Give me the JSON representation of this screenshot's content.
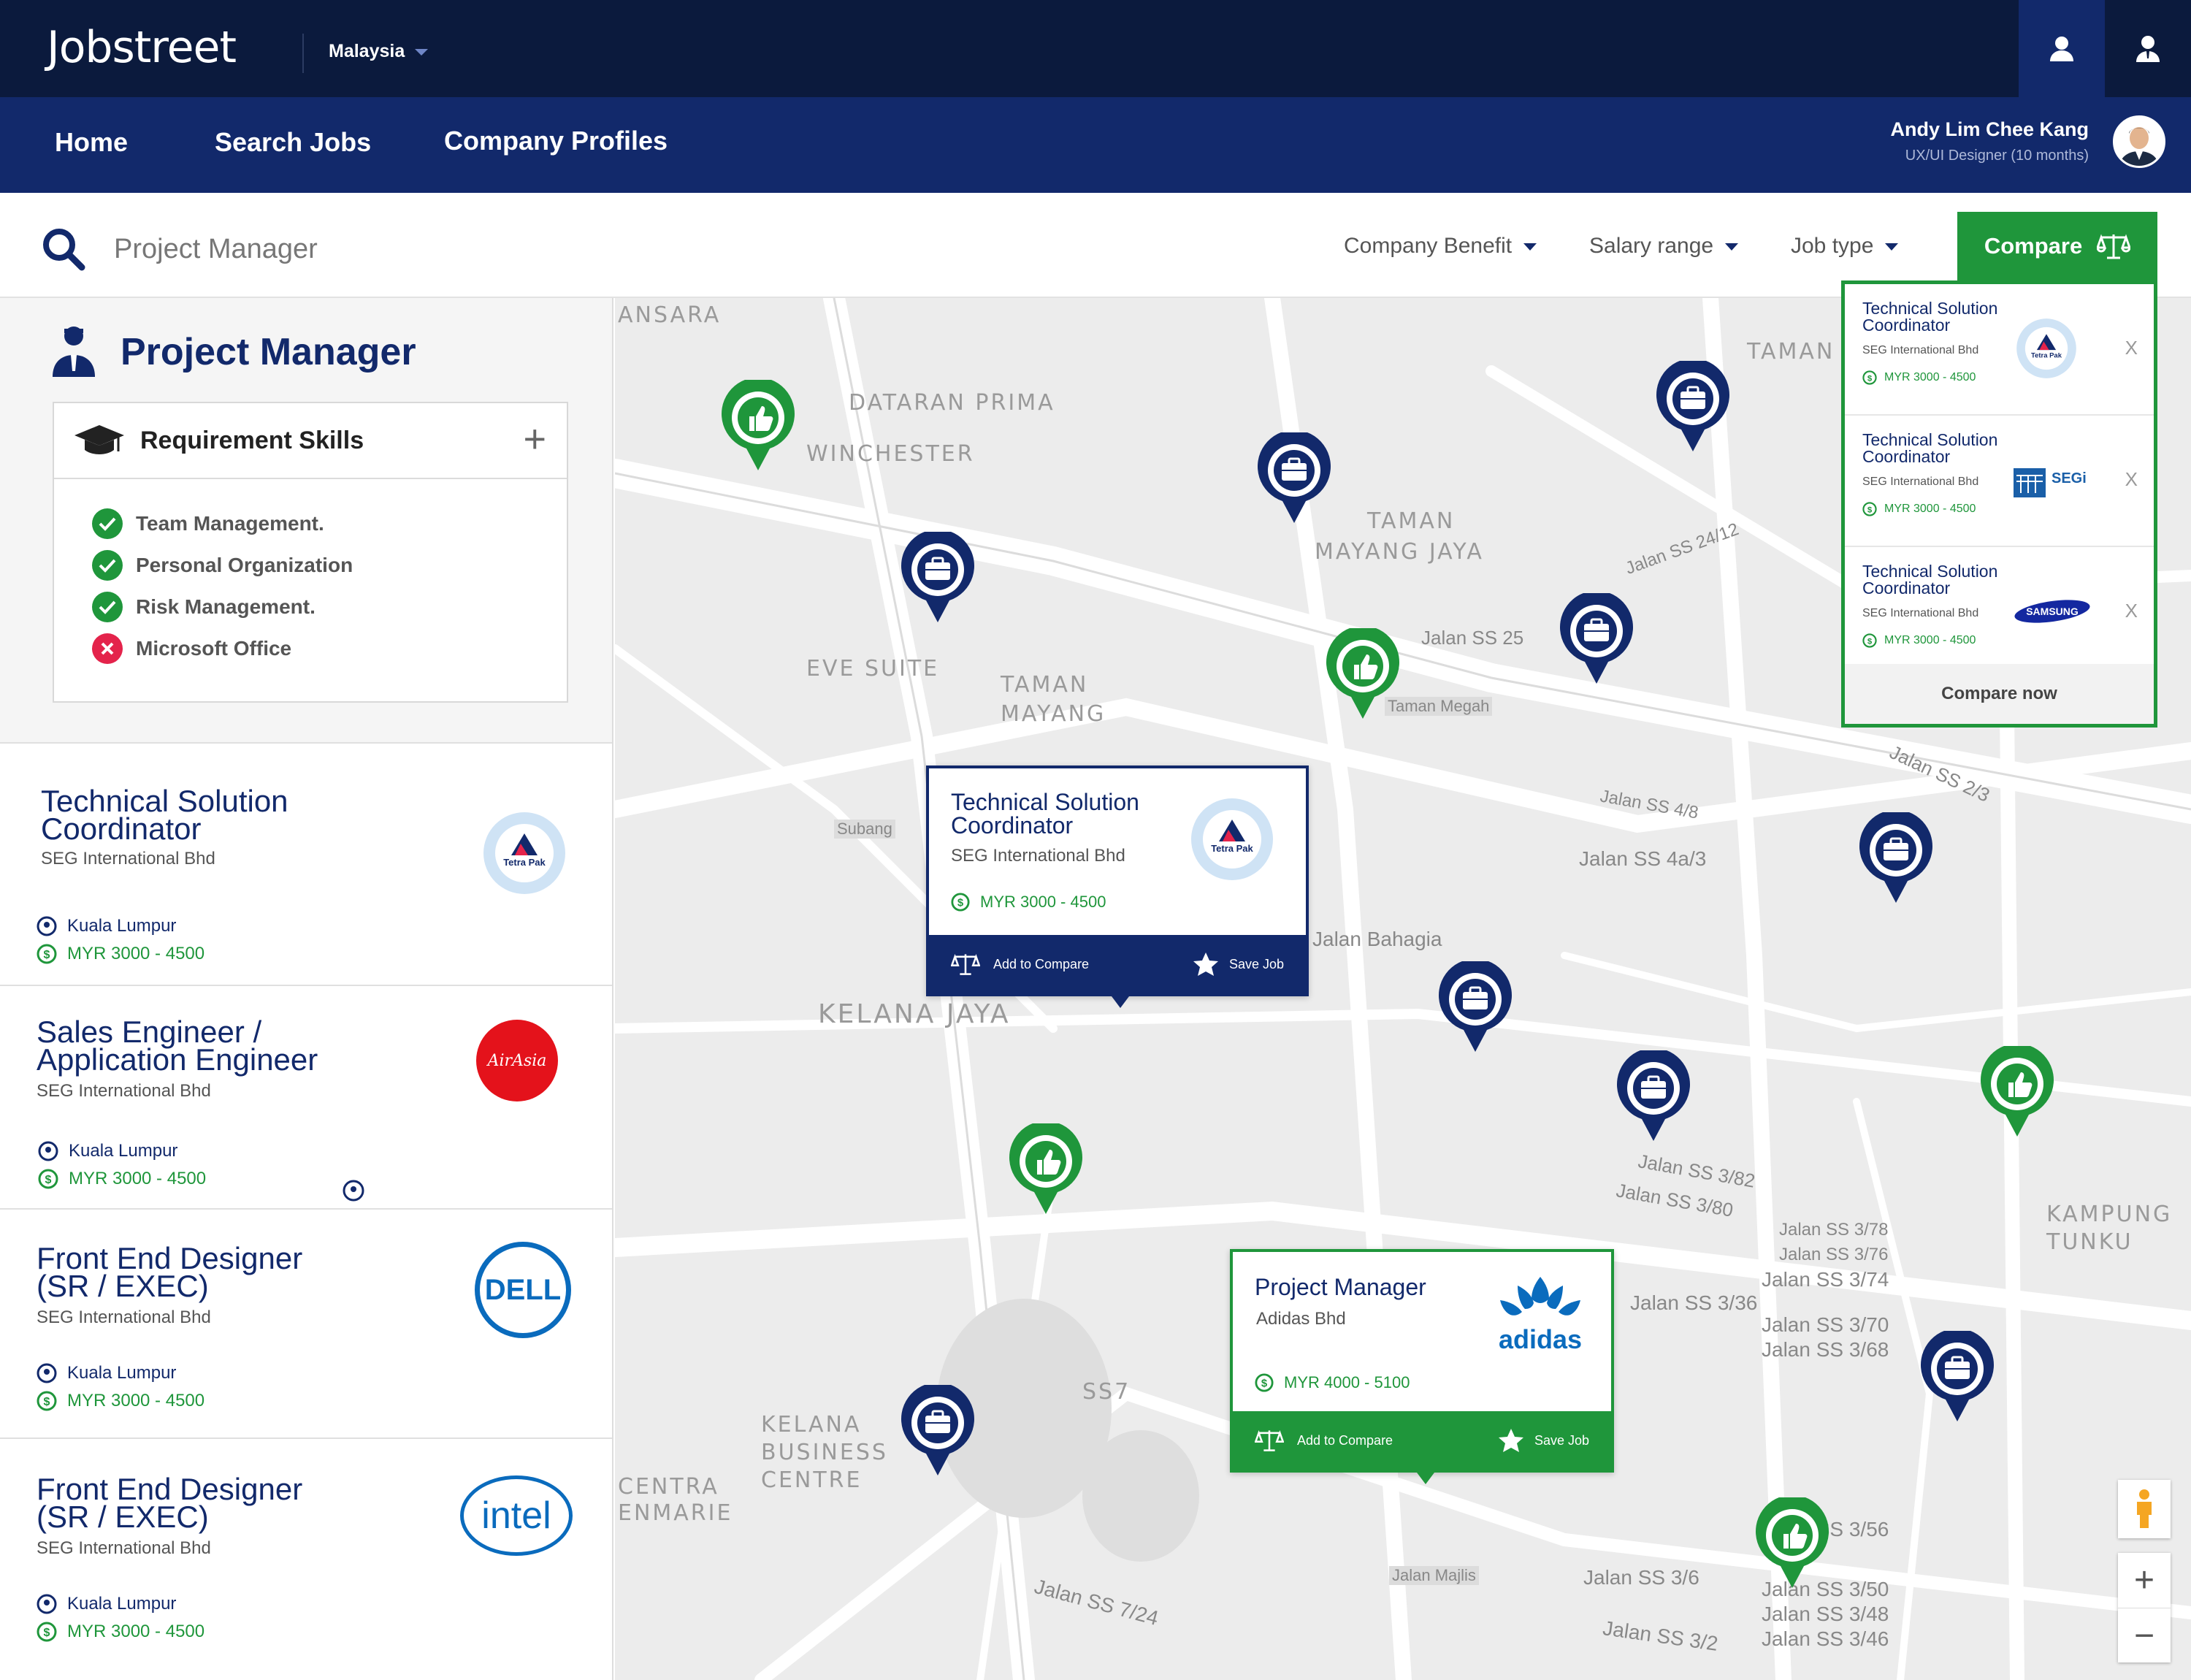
{
  "header": {
    "logo": "Jobstreet",
    "country": "Malaysia",
    "nav": [
      "Home",
      "Search Jobs",
      "Company Profiles"
    ],
    "user": {
      "name": "Andy Lim Chee Kang",
      "role": "UX/UI Designer (10 months)"
    }
  },
  "search": {
    "query": "Project Manager",
    "filters": [
      "Company Benefit",
      "Salary range",
      "Job type"
    ],
    "compare_label": "Compare"
  },
  "profile": {
    "title": "Project Manager",
    "requirements_title": "Requirement Skills",
    "skills": [
      {
        "label": "Team Management.",
        "met": true
      },
      {
        "label": "Personal Organization",
        "met": true
      },
      {
        "label": "Risk Management.",
        "met": true
      },
      {
        "label": "Microsoft Office",
        "met": false
      }
    ]
  },
  "jobs": [
    {
      "title1": "Technical Solution",
      "title2": "Coordinator",
      "company": "SEG International Bhd",
      "location": "Kuala Lumpur",
      "salary": "MYR 3000 - 4500",
      "logo": "tetrapak"
    },
    {
      "title1": "Sales Engineer /",
      "title2": "Application Engineer",
      "company": "SEG International Bhd",
      "location": "Kuala Lumpur",
      "salary": "MYR 3000 - 4500",
      "logo": "airasia"
    },
    {
      "title1": "Front End Designer",
      "title2": "(SR / EXEC)",
      "company": "SEG International Bhd",
      "location": "Kuala Lumpur",
      "salary": "MYR 3000 - 4500",
      "logo": "dell"
    },
    {
      "title1": "Front End Designer",
      "title2": "(SR / EXEC)",
      "company": "SEG International Bhd",
      "location": "Kuala Lumpur",
      "salary": "MYR 3000 - 4500",
      "logo": "intel"
    }
  ],
  "logos": {
    "tetrapak": "Tetra Pak",
    "airasia": "AirAsia",
    "dell": "DELL",
    "intel": "intel",
    "adidas": "adidas",
    "segi": "SEGi",
    "samsung": "SAMSUNG"
  },
  "map_cards": [
    {
      "title1": "Technical Solution",
      "title2": "Coordinator",
      "company": "SEG International Bhd",
      "salary": "MYR 3000 - 4500",
      "add_compare": "Add to Compare",
      "save": "Save Job"
    },
    {
      "title1": "Project Manager",
      "title2": "",
      "company": "Adidas Bhd",
      "salary": "MYR 4000 - 5100",
      "add_compare": "Add to Compare",
      "save": "Save Job"
    }
  ],
  "compare_panel": {
    "items": [
      {
        "title1": "Technical Solution",
        "title2": "Coordinator",
        "company": "SEG International Bhd",
        "salary": "MYR 3000 - 4500",
        "remove": "X",
        "logo": "tetrapak"
      },
      {
        "title1": "Technical Solution",
        "title2": "Coordinator",
        "company": "SEG International Bhd",
        "salary": "MYR 3000 - 4500",
        "remove": "X",
        "logo": "segi"
      },
      {
        "title1": "Technical Solution",
        "title2": "Coordinator",
        "company": "SEG International Bhd",
        "salary": "MYR 3000 - 4500",
        "remove": "X",
        "logo": "samsung"
      }
    ],
    "cta": "Compare now"
  },
  "map_labels": [
    "ANSARA",
    "DATARAN PRIMA",
    "MAYANG JAYA",
    "TAMAN",
    "EVE SUITE",
    "TAMAN MAYANG",
    "KELANA JAYA",
    "KELANA BUSINESS CENTRE",
    "SS7",
    "KAMPUNG TUNKU",
    "TAMAN",
    "WINCHESTER",
    "CENTRA",
    "ENMARIE"
  ],
  "road_labels": [
    "Jalan SS 25",
    "Jalan SS 24/12",
    "Jalan Bahagia",
    "Jalan SS 4a/3",
    "Jalan SS 4/8",
    "Jalan SS 3/82",
    "Jalan SS 3/80",
    "Jalan SS 3/78",
    "Jalan SS 3/76",
    "Jalan SS 3/74",
    "Jalan SS 3/70",
    "Jalan SS 3/68",
    "Jalan SS 3/36",
    "Jalan SS 3/56",
    "Jalan SS 3/50",
    "Jalan SS 3/48",
    "Jalan SS 3/46",
    "Jalan SS 3/6",
    "Jalan SS 3/2",
    "Jalan SS 7/24",
    "Jalan SS 2/3",
    "Taman Megah",
    "Jalan Majlis",
    "Subang"
  ],
  "colors": {
    "navy": "#12296b",
    "dark_navy": "#0b1a3d",
    "green": "#1f963b",
    "red": "#e4234b"
  }
}
